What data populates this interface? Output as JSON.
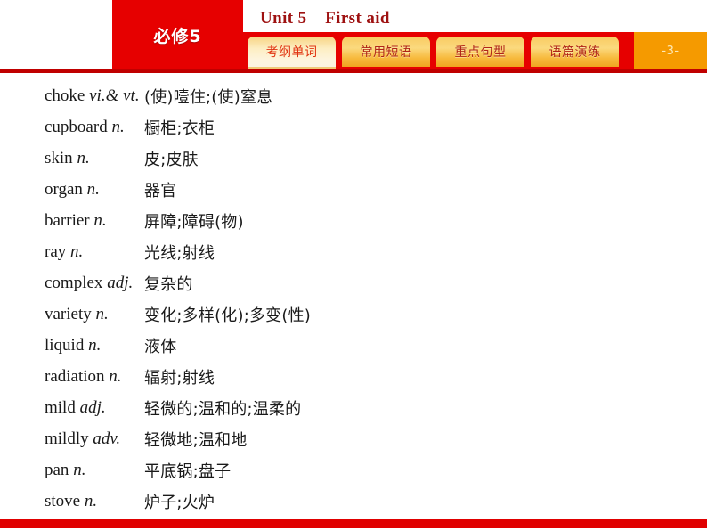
{
  "header": {
    "volume_label": "必修5",
    "unit_title": "Unit 5    First aid",
    "page_number": "-3-",
    "tabs": [
      {
        "label": "考纲单词",
        "active": true
      },
      {
        "label": "常用短语",
        "active": false
      },
      {
        "label": "重点句型",
        "active": false
      },
      {
        "label": "语篇演练",
        "active": false
      }
    ]
  },
  "colors": {
    "brand_red": "#e60000",
    "rule_red": "#c00000",
    "title_red": "#9e1111",
    "tab_gold": "#f8cb62",
    "tab_active_cream": "#fdf4dd",
    "page_orange": "#f59a00",
    "tab_text_red": "#b02417",
    "tab_active_text_red": "#e03311"
  },
  "word_list": [
    {
      "word": "choke",
      "pos": "vi.& vt.",
      "meaning": "(使)噎住;(使)窒息"
    },
    {
      "word": "cupboard",
      "pos": "n.",
      "meaning": "橱柜;衣柜"
    },
    {
      "word": "skin",
      "pos": "n.",
      "meaning": "皮;皮肤"
    },
    {
      "word": "organ",
      "pos": "n.",
      "meaning": "器官"
    },
    {
      "word": "barrier",
      "pos": "n.",
      "meaning": "屏障;障碍(物)"
    },
    {
      "word": "ray",
      "pos": "n.",
      "meaning": "光线;射线"
    },
    {
      "word": "complex",
      "pos": "adj.",
      "meaning": "复杂的"
    },
    {
      "word": "variety",
      "pos": "n.",
      "meaning": "变化;多样(化);多变(性)"
    },
    {
      "word": "liquid",
      "pos": "n.",
      "meaning": "液体"
    },
    {
      "word": "radiation",
      "pos": "n.",
      "meaning": "辐射;射线"
    },
    {
      "word": "mild",
      "pos": "adj.",
      "meaning": "轻微的;温和的;温柔的"
    },
    {
      "word": "mildly",
      "pos": "adv.",
      "meaning": "轻微地;温和地"
    },
    {
      "word": "pan",
      "pos": "n.",
      "meaning": "平底锅;盘子"
    },
    {
      "word": "stove",
      "pos": "n.",
      "meaning": "炉子;火炉"
    }
  ]
}
